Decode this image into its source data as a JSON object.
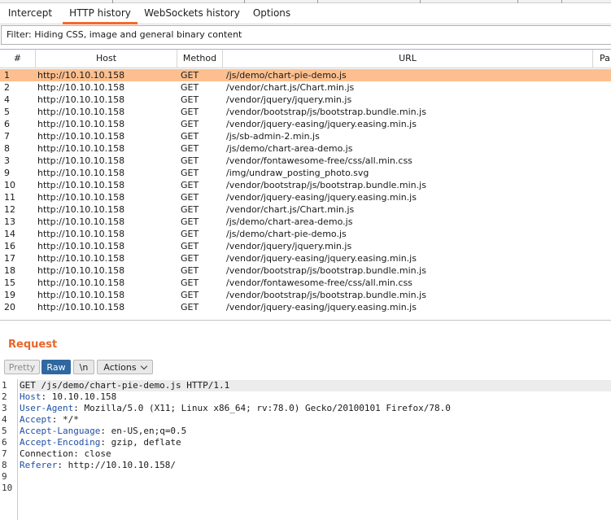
{
  "tabs": [
    {
      "label": "Intercept"
    },
    {
      "label": "HTTP history",
      "active": true
    },
    {
      "label": "WebSockets history"
    },
    {
      "label": "Options"
    }
  ],
  "filter": {
    "text": "Filter: Hiding CSS, image and general binary content"
  },
  "table": {
    "headers": {
      "num": "#",
      "host": "Host",
      "method": "Method",
      "url": "URL",
      "params": "Pa"
    },
    "rows": [
      {
        "num": "1",
        "host": "http://10.10.10.158",
        "method": "GET",
        "url": "/js/demo/chart-pie-demo.js",
        "selected": true
      },
      {
        "num": "2",
        "host": "http://10.10.10.158",
        "method": "GET",
        "url": "/vendor/chart.js/Chart.min.js"
      },
      {
        "num": "4",
        "host": "http://10.10.10.158",
        "method": "GET",
        "url": "/vendor/jquery/jquery.min.js"
      },
      {
        "num": "5",
        "host": "http://10.10.10.158",
        "method": "GET",
        "url": "/vendor/bootstrap/js/bootstrap.bundle.min.js"
      },
      {
        "num": "6",
        "host": "http://10.10.10.158",
        "method": "GET",
        "url": "/vendor/jquery-easing/jquery.easing.min.js"
      },
      {
        "num": "7",
        "host": "http://10.10.10.158",
        "method": "GET",
        "url": "/js/sb-admin-2.min.js"
      },
      {
        "num": "8",
        "host": "http://10.10.10.158",
        "method": "GET",
        "url": "/js/demo/chart-area-demo.js"
      },
      {
        "num": "3",
        "host": "http://10.10.10.158",
        "method": "GET",
        "url": "/vendor/fontawesome-free/css/all.min.css"
      },
      {
        "num": "9",
        "host": "http://10.10.10.158",
        "method": "GET",
        "url": "/img/undraw_posting_photo.svg"
      },
      {
        "num": "10",
        "host": "http://10.10.10.158",
        "method": "GET",
        "url": "/vendor/bootstrap/js/bootstrap.bundle.min.js"
      },
      {
        "num": "11",
        "host": "http://10.10.10.158",
        "method": "GET",
        "url": "/vendor/jquery-easing/jquery.easing.min.js"
      },
      {
        "num": "12",
        "host": "http://10.10.10.158",
        "method": "GET",
        "url": "/vendor/chart.js/Chart.min.js"
      },
      {
        "num": "13",
        "host": "http://10.10.10.158",
        "method": "GET",
        "url": "/js/demo/chart-area-demo.js"
      },
      {
        "num": "14",
        "host": "http://10.10.10.158",
        "method": "GET",
        "url": "/js/demo/chart-pie-demo.js"
      },
      {
        "num": "16",
        "host": "http://10.10.10.158",
        "method": "GET",
        "url": "/vendor/jquery/jquery.min.js"
      },
      {
        "num": "17",
        "host": "http://10.10.10.158",
        "method": "GET",
        "url": "/vendor/jquery-easing/jquery.easing.min.js"
      },
      {
        "num": "18",
        "host": "http://10.10.10.158",
        "method": "GET",
        "url": "/vendor/bootstrap/js/bootstrap.bundle.min.js"
      },
      {
        "num": "15",
        "host": "http://10.10.10.158",
        "method": "GET",
        "url": "/vendor/fontawesome-free/css/all.min.css"
      },
      {
        "num": "19",
        "host": "http://10.10.10.158",
        "method": "GET",
        "url": "/vendor/bootstrap/js/bootstrap.bundle.min.js"
      },
      {
        "num": "20",
        "host": "http://10.10.10.158",
        "method": "GET",
        "url": "/vendor/jquery-easing/jquery.easing.min.js"
      }
    ]
  },
  "request": {
    "title": "Request",
    "buttons": {
      "pretty": "Pretty",
      "raw": "Raw",
      "newline": "\\n",
      "actions": "Actions"
    },
    "line_numbers": [
      "1",
      "2",
      "3",
      "4",
      "5",
      "6",
      "7",
      "8",
      "9",
      "10"
    ],
    "lines": [
      {
        "name": "",
        "value": "GET /js/demo/chart-pie-demo.js HTTP/1.1"
      },
      {
        "name": "Host",
        "value": ": 10.10.10.158"
      },
      {
        "name": "User-Agent",
        "value": ": Mozilla/5.0 (X11; Linux x86_64; rv:78.0) Gecko/20100101 Firefox/78.0"
      },
      {
        "name": "Accept",
        "value": ": */*"
      },
      {
        "name": "Accept-Language",
        "value": ": en-US,en;q=0.5"
      },
      {
        "name": "Accept-Encoding",
        "value": ": gzip, deflate"
      },
      {
        "name": "",
        "value": "Connection: close"
      },
      {
        "name": "Referer",
        "value": ": http://10.10.10.158/"
      },
      {
        "name": "",
        "value": ""
      },
      {
        "name": "",
        "value": ""
      }
    ]
  },
  "colors": {
    "accent": "#f26a2a",
    "selected_row": "#fdbf8f",
    "raw_button": "#2f68a1",
    "header_name": "#1f4fa3"
  }
}
